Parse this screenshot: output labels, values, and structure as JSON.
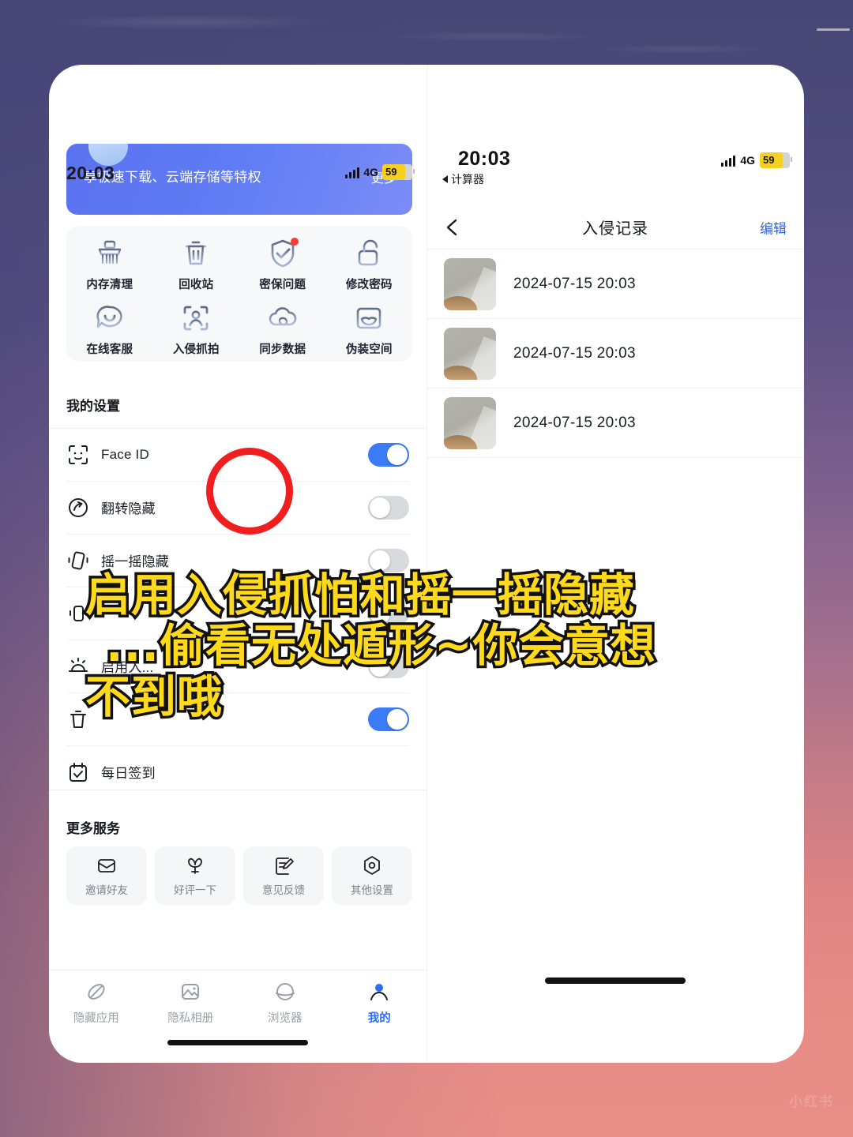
{
  "background": {
    "gradient_top": "#474674",
    "gradient_bottom": "#ea8f88",
    "watermark": "小红书"
  },
  "left_phone": {
    "status_bar": {
      "time": "20:03",
      "network": "4G",
      "battery": "59"
    },
    "promo_banner": {
      "text": "享极速下载、云端存储等特权",
      "action": "更多"
    },
    "quick_grid": {
      "rows": [
        [
          {
            "icon": "broom-icon",
            "label": "内存清理",
            "badge": false
          },
          {
            "icon": "trash-icon",
            "label": "回收站",
            "badge": false
          },
          {
            "icon": "shield-check-icon",
            "label": "密保问题",
            "badge": true
          },
          {
            "icon": "unlock-icon",
            "label": "修改密码",
            "badge": false
          }
        ],
        [
          {
            "icon": "chat-smile-icon",
            "label": "在线客服",
            "badge": false
          },
          {
            "icon": "face-capture-icon",
            "label": "入侵抓拍",
            "badge": false
          },
          {
            "icon": "cloud-sync-icon",
            "label": "同步数据",
            "badge": false
          },
          {
            "icon": "mask-window-icon",
            "label": "伪装空间",
            "badge": false
          }
        ]
      ]
    },
    "annotation": {
      "shape": "circle",
      "color": "#f01e1e",
      "targets": "入侵抓拍"
    },
    "settings_section": {
      "heading": "我的设置",
      "rows": [
        {
          "icon": "face-id-icon",
          "label": "Face ID",
          "toggle": "on"
        },
        {
          "icon": "rotate-hide-icon",
          "label": "翻转隐藏",
          "toggle": "off"
        },
        {
          "icon": "shake-phone-icon",
          "label": "摇一摇隐藏",
          "toggle": "off"
        },
        {
          "icon": "phone-vibrate-icon",
          "label": "",
          "toggle": "off"
        },
        {
          "icon": "alarm-icon",
          "label": "启用入...",
          "toggle": "off"
        },
        {
          "icon": "trash-outline-icon",
          "label": "",
          "toggle": "on"
        },
        {
          "icon": "calendar-check-icon",
          "label": "每日签到",
          "toggle": "none"
        }
      ]
    },
    "more_section": {
      "heading": "更多服务",
      "items": [
        {
          "icon": "envelope-icon",
          "label": "邀请好友"
        },
        {
          "icon": "flower-icon",
          "label": "好评一下"
        },
        {
          "icon": "feedback-edit-icon",
          "label": "意见反馈"
        },
        {
          "icon": "hex-gear-icon",
          "label": "其他设置"
        }
      ]
    },
    "tab_bar": {
      "tabs": [
        {
          "icon": "hidden-apps-icon",
          "label": "隐藏应用",
          "active": false
        },
        {
          "icon": "private-album-icon",
          "label": "隐私相册",
          "active": false
        },
        {
          "icon": "browser-icon",
          "label": "浏览器",
          "active": false
        },
        {
          "icon": "profile-icon",
          "label": "我的",
          "active": true
        }
      ],
      "active_color": "#2f6df0"
    }
  },
  "right_phone": {
    "status_bar": {
      "time": "20:03",
      "back_app": "计算器",
      "network": "4G",
      "battery": "59"
    },
    "nav_bar": {
      "back_icon": "chevron-left-icon",
      "title": "入侵记录",
      "edit_label": "编辑",
      "edit_color": "#2f63e8"
    },
    "records": [
      {
        "thumbnail": "intruder-photo",
        "datetime": "2024-07-15 20:03"
      },
      {
        "thumbnail": "intruder-photo",
        "datetime": "2024-07-15 20:03"
      },
      {
        "thumbnail": "intruder-photo",
        "datetime": "2024-07-15 20:03"
      }
    ]
  },
  "caption": {
    "line1": "启用入侵抓怕和摇一摇隐藏",
    "line2": "...偷看无处遁形~你会意想",
    "line3": "不到哦",
    "fill_color": "#ffd91c",
    "stroke_color": "#111111"
  }
}
